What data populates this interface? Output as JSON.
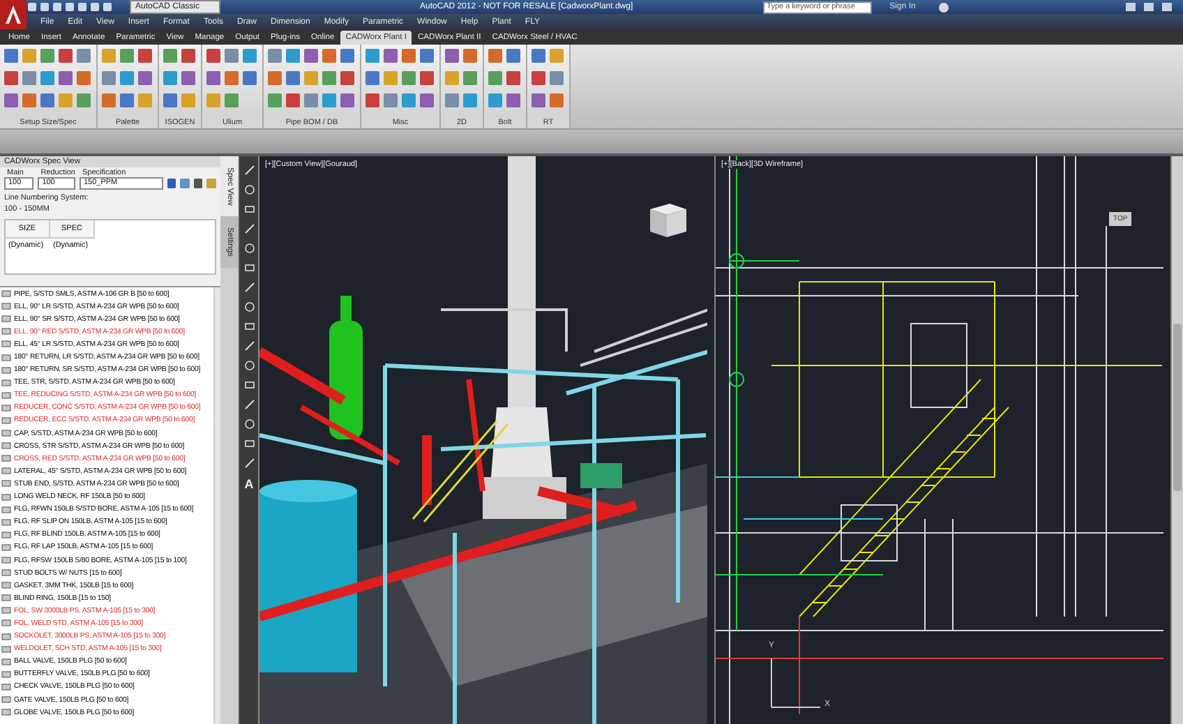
{
  "title_bar": {
    "workspace": "AutoCAD Classic",
    "title": "AutoCAD 2012 - NOT FOR RESALE   [CadworxPlant.dwg]",
    "search": {
      "placeholder": "Type a keyword or phrase"
    },
    "sign_in": "Sign In"
  },
  "menu_bar": [
    "File",
    "Edit",
    "View",
    "Insert",
    "Format",
    "Tools",
    "Draw",
    "Dimension",
    "Modify",
    "Parametric",
    "Window",
    "Help",
    "Plant",
    "FLY"
  ],
  "ribbon_tabs": [
    {
      "label": "Home",
      "selected": false
    },
    {
      "label": "Insert",
      "selected": false
    },
    {
      "label": "Annotate",
      "selected": false
    },
    {
      "label": "Parametric",
      "selected": false
    },
    {
      "label": "View",
      "selected": false
    },
    {
      "label": "Manage",
      "selected": false
    },
    {
      "label": "Output",
      "selected": false
    },
    {
      "label": "Plug-ins",
      "selected": false
    },
    {
      "label": "Online",
      "selected": false
    },
    {
      "label": "CADWorx Plant I",
      "selected": true
    },
    {
      "label": "CADWorx Plant II",
      "selected": false
    },
    {
      "label": "CADWorx Steel / HVAC",
      "selected": false
    }
  ],
  "ribbon_panels": [
    "Setup Size/Spec",
    "Palette",
    "ISOGEN",
    "Ulium",
    "Pipe BOM / DB",
    "Misc",
    "2D",
    "Bolt",
    "RT"
  ],
  "spec_view": {
    "title": "CADWorx Spec View",
    "fields": [
      {
        "label": "Main",
        "value": "100"
      },
      {
        "label": "Reduction",
        "value": "100"
      },
      {
        "label": "Specification",
        "value": "150_PPM"
      }
    ],
    "line_numbering_label": "Line Numbering System:",
    "line_numbering_value": "100 - 150MM",
    "table": {
      "columns": [
        "SIZE",
        "SPEC"
      ],
      "row": [
        "(Dynamic)",
        "(Dynamic)"
      ]
    },
    "side_tabs": [
      {
        "label": "Spec View",
        "selected": true
      },
      {
        "label": "Settings",
        "selected": false
      }
    ],
    "components": [
      {
        "text": "PIPE, S/STD SMLS, ASTM A-106 GR B [50 to 600]",
        "flagged": false
      },
      {
        "text": "ELL, 90° LR S/STD, ASTM A-234 GR WPB [50 to 600]",
        "flagged": false
      },
      {
        "text": "ELL, 90° SR S/STD, ASTM A-234 GR WPB [50 to 600]",
        "flagged": false
      },
      {
        "text": "ELL, 90° RED S/STD, ASTM A-234 GR WPB [50 to 600]",
        "flagged": true
      },
      {
        "text": "ELL, 45° LR S/STD, ASTM A-234 GR WPB [50 to 600]",
        "flagged": false
      },
      {
        "text": "180° RETURN, LR S/STD, ASTM A-234 GR WPB [50 to 600]",
        "flagged": false
      },
      {
        "text": "180° RETURN, SR S/STD, ASTM A-234 GR WPB [50 to 600]",
        "flagged": false
      },
      {
        "text": "TEE, STR, S/STD, ASTM A-234 GR WPB [50 to 600]",
        "flagged": false
      },
      {
        "text": "TEE, REDUCING S/STD, ASTM A-234 GR WPB [50 to 600]",
        "flagged": true
      },
      {
        "text": "REDUCER, CONC S/STD, ASTM A-234 GR WPB [50 to 600]",
        "flagged": true
      },
      {
        "text": "REDUCER, ECC S/STD, ASTM A-234 GR WPB [50 to 600]",
        "flagged": true
      },
      {
        "text": "CAP, S/STD, ASTM A-234 GR WPB [50 to 600]",
        "flagged": false
      },
      {
        "text": "CROSS, STR S/STD, ASTM A-234 GR WPB [50 to 600]",
        "flagged": false
      },
      {
        "text": "CROSS, RED S/STD, ASTM A-234 GR WPB [50 to 600]",
        "flagged": true
      },
      {
        "text": "LATERAL, 45° S/STD, ASTM A-234 GR WPB [50 to 600]",
        "flagged": false
      },
      {
        "text": "STUB END, S/STD, ASTM A-234 GR WPB [50 to 600]",
        "flagged": false
      },
      {
        "text": "LONG WELD NECK, RF 150LB [50 to 600]",
        "flagged": false
      },
      {
        "text": "FLG, RFWN 150LB S/STD BORE, ASTM A-105 [15 to 600]",
        "flagged": false
      },
      {
        "text": "FLG, RF SLIP ON 150LB, ASTM A-105 [15 to 600]",
        "flagged": false
      },
      {
        "text": "FLG, RF BLIND 150LB, ASTM A-105 [15 to 600]",
        "flagged": false
      },
      {
        "text": "FLG, RF LAP 150LB, ASTM A-105 [15 to 600]",
        "flagged": false
      },
      {
        "text": "FLG, RFSW 150LB S/80 BORE, ASTM A-105 [15 to 100]",
        "flagged": false
      },
      {
        "text": "STUD BOLTS W/ NUTS [15 to 600]",
        "flagged": false
      },
      {
        "text": "GASKET, 3MM THK, 150LB [15 to 600]",
        "flagged": false
      },
      {
        "text": "BLIND RING, 150LB [15 to 150]",
        "flagged": false
      },
      {
        "text": "FOL, SW 3000LB PS, ASTM A-105 [15 to 300]",
        "flagged": true
      },
      {
        "text": "FOL, WELD STD, ASTM A-105 [15 to 300]",
        "flagged": true
      },
      {
        "text": "SOCKOLET, 3000LB PS, ASTM A-105 [15 to 300]",
        "flagged": true
      },
      {
        "text": "WELDOLET, SCH STD, ASTM A-105 [15 to 300]",
        "flagged": true
      },
      {
        "text": "BALL VALVE, 150LB PLG [50 to 600]",
        "flagged": false
      },
      {
        "text": "BUTTERFLY VALVE, 150LB PLG [50 to 600]",
        "flagged": false
      },
      {
        "text": "CHECK VALVE, 150LB PLG [50 to 600]",
        "flagged": false
      },
      {
        "text": "GATE VALVE, 150LB PLG [50 to 600]",
        "flagged": false
      },
      {
        "text": "GLOBE VALVE, 150LB PLG [50 to 600]",
        "flagged": false
      }
    ]
  },
  "tool_strip": {
    "text_tool": "A"
  },
  "viewports": [
    {
      "label": "[+][Custom View][Gouraud]",
      "kind": "shaded"
    },
    {
      "label": "[+][Back][3D Wireframe]",
      "kind": "wireframe",
      "cube_label": "TOP",
      "axis_x": "X",
      "axis_y": "Y"
    }
  ]
}
